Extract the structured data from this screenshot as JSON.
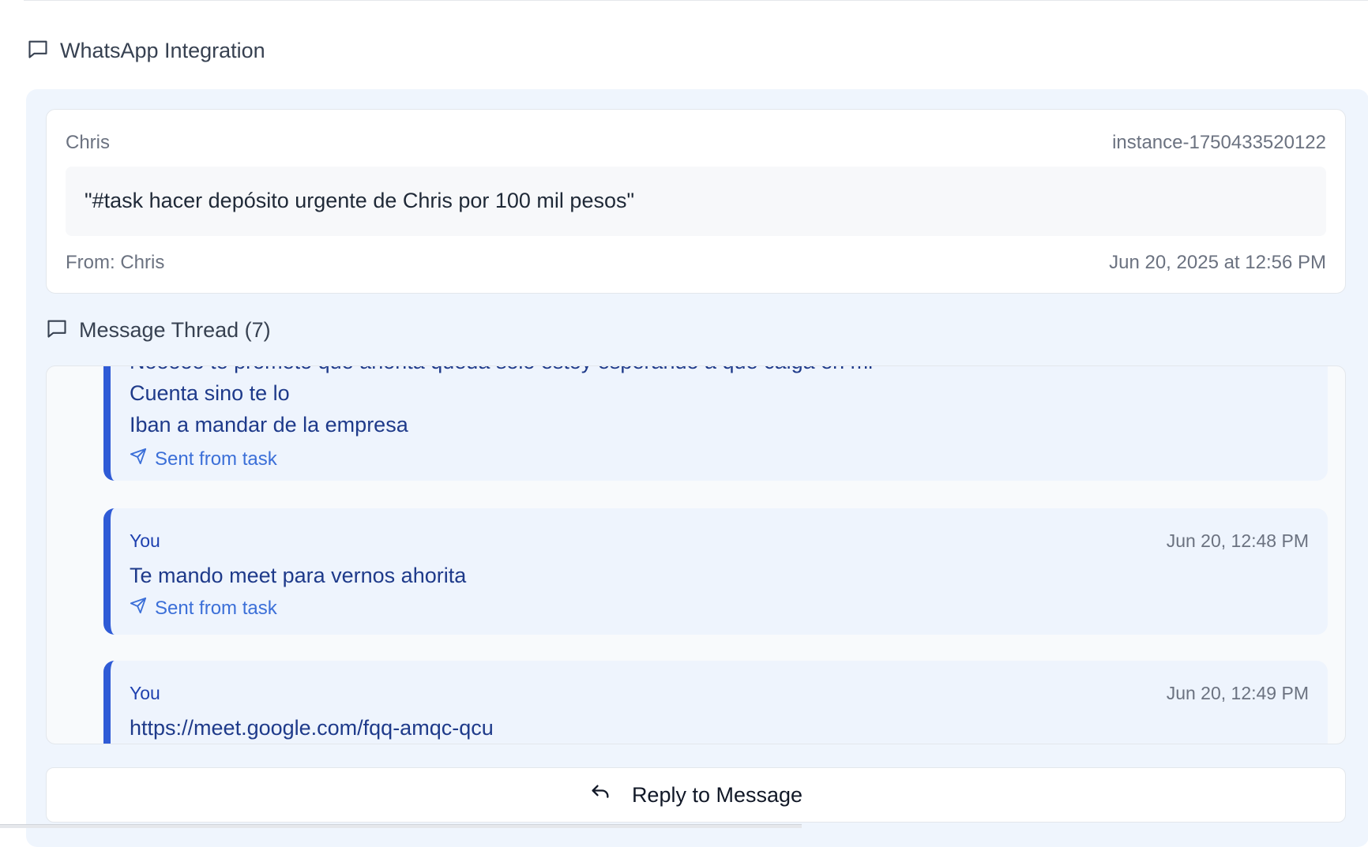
{
  "section": {
    "title": "WhatsApp Integration",
    "icon": "message-square-icon"
  },
  "message_card": {
    "sender": "Chris",
    "instance": "instance-1750433520122",
    "text": "\"#task hacer depósito urgente de Chris por 100 mil pesos\"",
    "from": "From: Chris",
    "date": "Jun 20, 2025 at 12:56 PM"
  },
  "thread": {
    "title": "Message Thread (7)",
    "icon": "message-square-icon",
    "messages": [
      {
        "lines": [
          "Nooooo te prometo que ahorita queda solo estoy esperando a que caiga en mi",
          "Cuenta sino te lo",
          "Iban a mandar de la empresa"
        ],
        "sent_label": "Sent from task"
      },
      {
        "author": "You",
        "time": "Jun 20, 12:48 PM",
        "text": "Te mando meet para vernos ahorita",
        "sent_label": "Sent from task"
      },
      {
        "author": "You",
        "time": "Jun 20, 12:49 PM",
        "text": "https://meet.google.com/fqq-amqc-qcu"
      }
    ]
  },
  "reply_button": {
    "label": "Reply to Message",
    "icon": "reply-arrow-icon"
  },
  "colors": {
    "accent": "#2f5bd6",
    "panel_bg": "#eff5fd",
    "bubble_bg": "#eef4fd",
    "link_blue": "#3b6fd8"
  }
}
